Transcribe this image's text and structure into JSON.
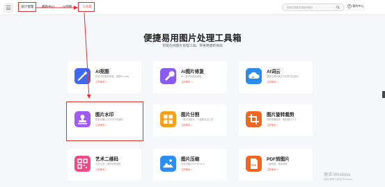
{
  "nav": {
    "items": [
      {
        "label": "设计管理"
      },
      {
        "label": "模板中心"
      },
      {
        "label": "AI绘图"
      },
      {
        "label": "工具箱"
      }
    ],
    "search_placeholder": "搜索您想要的模板和素材",
    "user_label": "我的中心"
  },
  "hero": {
    "title": "便捷易用图片处理工具箱",
    "subtitle": "智能在线图片处理工具，带来便捷新体验"
  },
  "tools": [
    {
      "title": "AI抠图",
      "desc": "精准识别智能抠图，抠图So easy",
      "action": "立即使用 >",
      "color": "#3e6af0",
      "icon": "magic-wand-icon"
    },
    {
      "title": "AI图片修复",
      "desc": "AI一键修复图片瑕疵",
      "action": "立即使用 >",
      "color": "#8b5bf5",
      "icon": "wrench-icon"
    },
    {
      "title": "AI词云",
      "desc": "智能生成精美文字创意词云图片",
      "action": "立即使用 >",
      "color": "#2b8cf0",
      "icon": "cloud-icon"
    },
    {
      "title": "图片水印",
      "desc": "批量加图片/文字水印至图片",
      "action": "立即使用 >",
      "color": "#a05cf2",
      "icon": "stamp-icon"
    },
    {
      "title": "图片分割",
      "desc": "一键切割图片，九宫格分割工具",
      "action": "立即使用 >",
      "color": "#f7a01c",
      "icon": "grid-split-icon"
    },
    {
      "title": "图片旋转裁剪",
      "desc": "简单快速旋转、裁剪图片尺寸",
      "action": "立即使用 >",
      "color": "#f2671f",
      "icon": "crop-icon"
    },
    {
      "title": "艺术二维码",
      "desc": "为您生成二维码创意海报",
      "action": "立即使用 >",
      "color": "#f04a86",
      "icon": "qrcode-icon"
    },
    {
      "title": "图片压缩",
      "desc": "在线压缩JPG/PNG大小",
      "action": "立即使用 >",
      "color": "#2f8ef4",
      "icon": "image-icon"
    },
    {
      "title": "PDF转图片",
      "desc": "一键转换，批量转换",
      "action": "立即使用 >",
      "color": "#f5641e",
      "icon": "pdf-icon"
    }
  ],
  "watermark": {
    "line1": "激活 Windows",
    "line2": "转到“设置”以激活 Windows。"
  },
  "colors": {
    "highlight": "#e03232",
    "accent": "#e8614f"
  }
}
